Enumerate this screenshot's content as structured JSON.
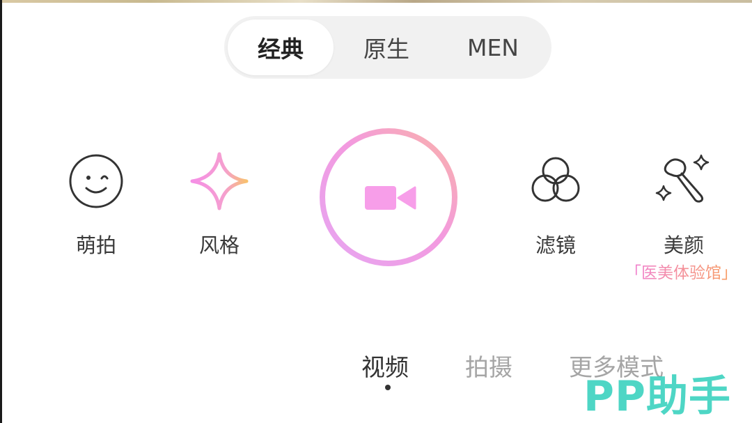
{
  "mode_tabs": {
    "items": [
      {
        "label": "经典"
      },
      {
        "label": "原生"
      },
      {
        "label": "MEN"
      }
    ],
    "selected": "经典"
  },
  "tools": {
    "cute_shot": {
      "label": "萌拍",
      "icon": "wink-face-icon"
    },
    "style": {
      "label": "风格",
      "icon": "sparkle-icon"
    },
    "filter": {
      "label": "滤镜",
      "icon": "filter-circles-icon"
    },
    "beauty": {
      "label": "美颜",
      "icon": "makeup-brush-icon",
      "sublabel": "「医美体验馆」"
    }
  },
  "shutter": {
    "icon": "video-camera-icon"
  },
  "capture_modes": {
    "items": [
      {
        "label": "视频"
      },
      {
        "label": "拍摄"
      },
      {
        "label": "更多模式"
      }
    ],
    "selected": "视频"
  },
  "watermark": {
    "text": "PP助手"
  },
  "colors": {
    "accent_pink": "#f49be8",
    "accent_orange": "#f8b27a",
    "accent_purple": "#e8a5f0",
    "watermark": "#3fd3c1"
  }
}
